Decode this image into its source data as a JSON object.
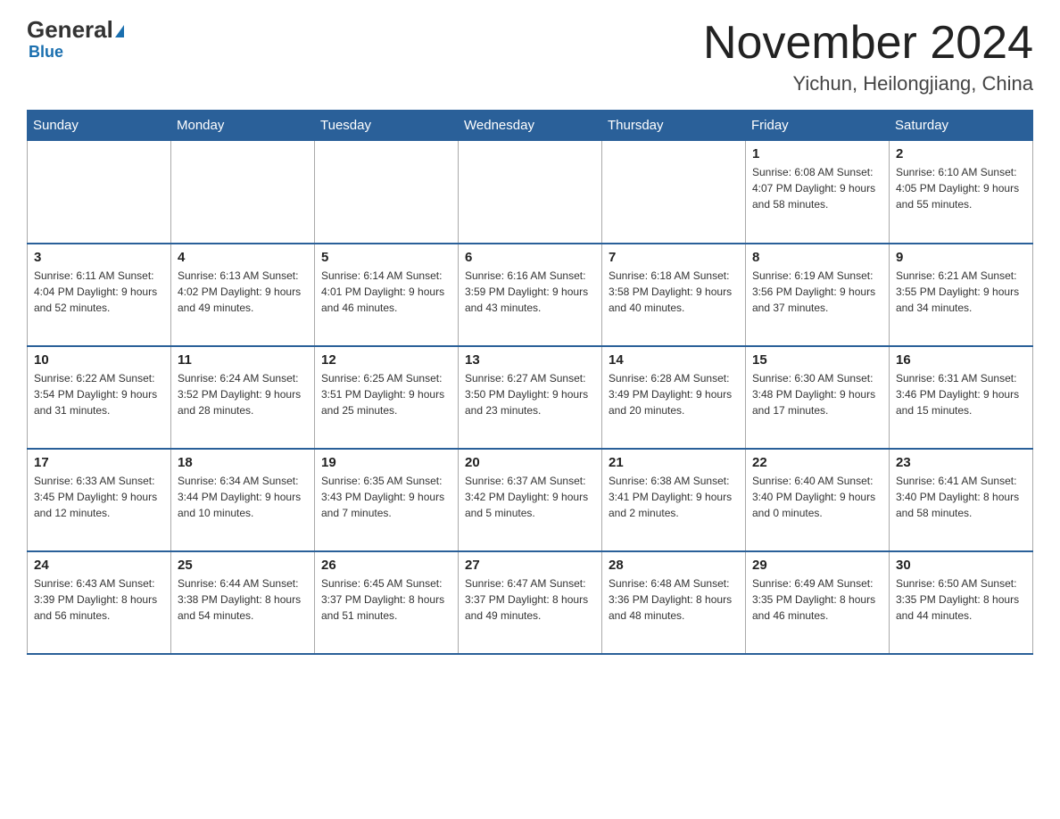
{
  "logo": {
    "general": "General",
    "blue": "Blue",
    "tagline": "Blue"
  },
  "header": {
    "month_year": "November 2024",
    "location": "Yichun, Heilongjiang, China"
  },
  "weekdays": [
    "Sunday",
    "Monday",
    "Tuesday",
    "Wednesday",
    "Thursday",
    "Friday",
    "Saturday"
  ],
  "weeks": [
    [
      {
        "day": "",
        "info": ""
      },
      {
        "day": "",
        "info": ""
      },
      {
        "day": "",
        "info": ""
      },
      {
        "day": "",
        "info": ""
      },
      {
        "day": "",
        "info": ""
      },
      {
        "day": "1",
        "info": "Sunrise: 6:08 AM\nSunset: 4:07 PM\nDaylight: 9 hours\nand 58 minutes."
      },
      {
        "day": "2",
        "info": "Sunrise: 6:10 AM\nSunset: 4:05 PM\nDaylight: 9 hours\nand 55 minutes."
      }
    ],
    [
      {
        "day": "3",
        "info": "Sunrise: 6:11 AM\nSunset: 4:04 PM\nDaylight: 9 hours\nand 52 minutes."
      },
      {
        "day": "4",
        "info": "Sunrise: 6:13 AM\nSunset: 4:02 PM\nDaylight: 9 hours\nand 49 minutes."
      },
      {
        "day": "5",
        "info": "Sunrise: 6:14 AM\nSunset: 4:01 PM\nDaylight: 9 hours\nand 46 minutes."
      },
      {
        "day": "6",
        "info": "Sunrise: 6:16 AM\nSunset: 3:59 PM\nDaylight: 9 hours\nand 43 minutes."
      },
      {
        "day": "7",
        "info": "Sunrise: 6:18 AM\nSunset: 3:58 PM\nDaylight: 9 hours\nand 40 minutes."
      },
      {
        "day": "8",
        "info": "Sunrise: 6:19 AM\nSunset: 3:56 PM\nDaylight: 9 hours\nand 37 minutes."
      },
      {
        "day": "9",
        "info": "Sunrise: 6:21 AM\nSunset: 3:55 PM\nDaylight: 9 hours\nand 34 minutes."
      }
    ],
    [
      {
        "day": "10",
        "info": "Sunrise: 6:22 AM\nSunset: 3:54 PM\nDaylight: 9 hours\nand 31 minutes."
      },
      {
        "day": "11",
        "info": "Sunrise: 6:24 AM\nSunset: 3:52 PM\nDaylight: 9 hours\nand 28 minutes."
      },
      {
        "day": "12",
        "info": "Sunrise: 6:25 AM\nSunset: 3:51 PM\nDaylight: 9 hours\nand 25 minutes."
      },
      {
        "day": "13",
        "info": "Sunrise: 6:27 AM\nSunset: 3:50 PM\nDaylight: 9 hours\nand 23 minutes."
      },
      {
        "day": "14",
        "info": "Sunrise: 6:28 AM\nSunset: 3:49 PM\nDaylight: 9 hours\nand 20 minutes."
      },
      {
        "day": "15",
        "info": "Sunrise: 6:30 AM\nSunset: 3:48 PM\nDaylight: 9 hours\nand 17 minutes."
      },
      {
        "day": "16",
        "info": "Sunrise: 6:31 AM\nSunset: 3:46 PM\nDaylight: 9 hours\nand 15 minutes."
      }
    ],
    [
      {
        "day": "17",
        "info": "Sunrise: 6:33 AM\nSunset: 3:45 PM\nDaylight: 9 hours\nand 12 minutes."
      },
      {
        "day": "18",
        "info": "Sunrise: 6:34 AM\nSunset: 3:44 PM\nDaylight: 9 hours\nand 10 minutes."
      },
      {
        "day": "19",
        "info": "Sunrise: 6:35 AM\nSunset: 3:43 PM\nDaylight: 9 hours\nand 7 minutes."
      },
      {
        "day": "20",
        "info": "Sunrise: 6:37 AM\nSunset: 3:42 PM\nDaylight: 9 hours\nand 5 minutes."
      },
      {
        "day": "21",
        "info": "Sunrise: 6:38 AM\nSunset: 3:41 PM\nDaylight: 9 hours\nand 2 minutes."
      },
      {
        "day": "22",
        "info": "Sunrise: 6:40 AM\nSunset: 3:40 PM\nDaylight: 9 hours\nand 0 minutes."
      },
      {
        "day": "23",
        "info": "Sunrise: 6:41 AM\nSunset: 3:40 PM\nDaylight: 8 hours\nand 58 minutes."
      }
    ],
    [
      {
        "day": "24",
        "info": "Sunrise: 6:43 AM\nSunset: 3:39 PM\nDaylight: 8 hours\nand 56 minutes."
      },
      {
        "day": "25",
        "info": "Sunrise: 6:44 AM\nSunset: 3:38 PM\nDaylight: 8 hours\nand 54 minutes."
      },
      {
        "day": "26",
        "info": "Sunrise: 6:45 AM\nSunset: 3:37 PM\nDaylight: 8 hours\nand 51 minutes."
      },
      {
        "day": "27",
        "info": "Sunrise: 6:47 AM\nSunset: 3:37 PM\nDaylight: 8 hours\nand 49 minutes."
      },
      {
        "day": "28",
        "info": "Sunrise: 6:48 AM\nSunset: 3:36 PM\nDaylight: 8 hours\nand 48 minutes."
      },
      {
        "day": "29",
        "info": "Sunrise: 6:49 AM\nSunset: 3:35 PM\nDaylight: 8 hours\nand 46 minutes."
      },
      {
        "day": "30",
        "info": "Sunrise: 6:50 AM\nSunset: 3:35 PM\nDaylight: 8 hours\nand 44 minutes."
      }
    ]
  ]
}
